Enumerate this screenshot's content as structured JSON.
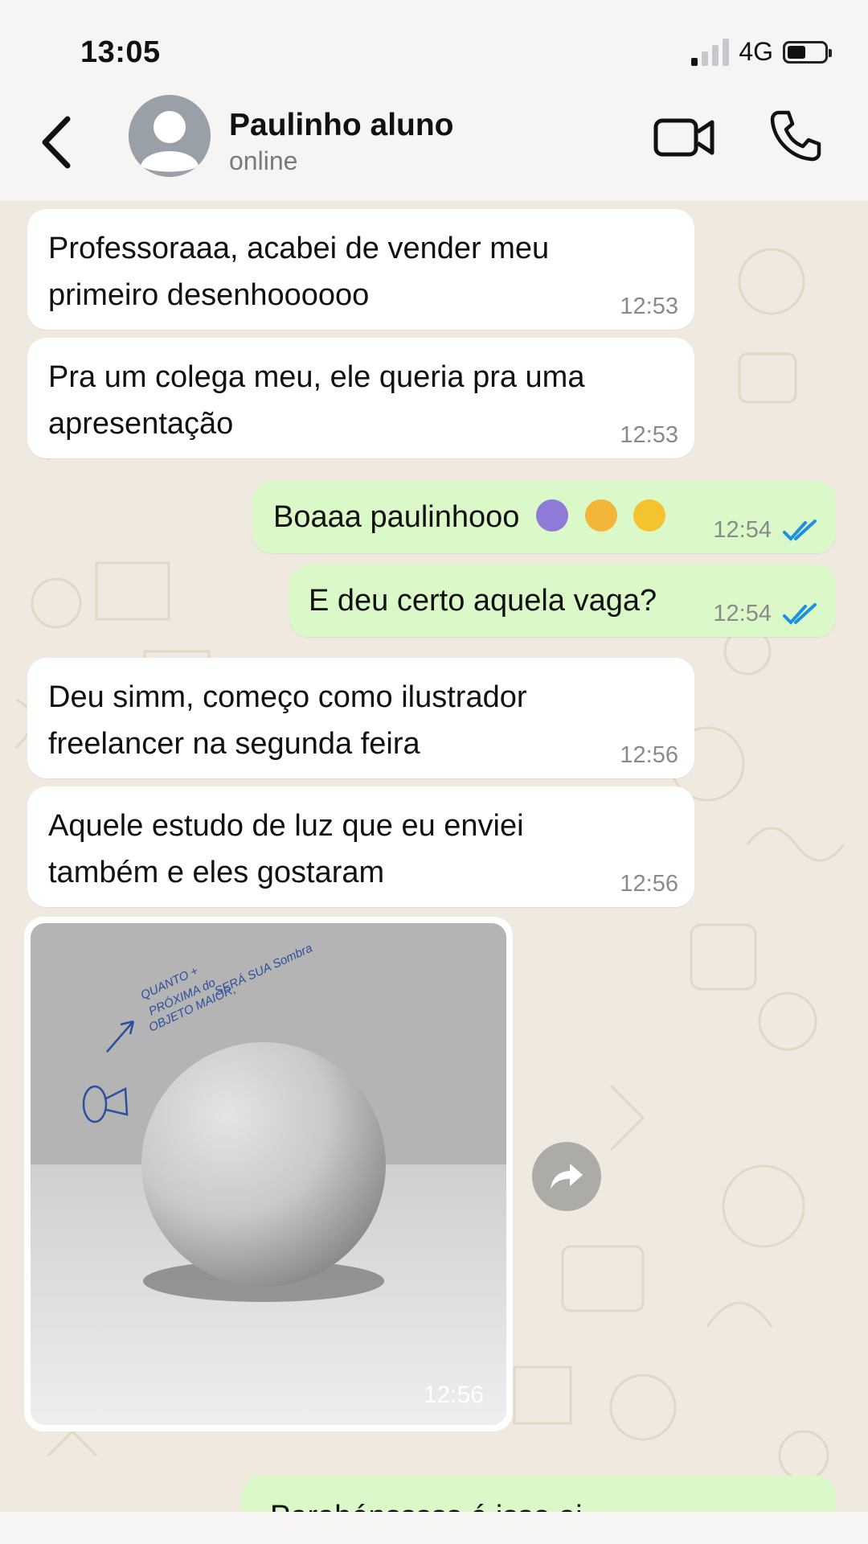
{
  "status_bar": {
    "time": "13:05",
    "network": "4G",
    "signal_bars_filled": 1,
    "battery_level": 0.45
  },
  "header": {
    "contact_name": "Paulinho aluno",
    "contact_status": "online",
    "icons": {
      "back": "chevron-left-icon",
      "avatar": "default-avatar-icon",
      "video": "video-camera-icon",
      "call": "phone-icon"
    }
  },
  "messages": [
    {
      "direction": "in",
      "text_line1": "Professoraaa, acabei de vender meu",
      "text_line2": "primeiro desenhoooooo",
      "time": "12:53"
    },
    {
      "direction": "in",
      "text_line1": "Pra um colega meu, ele queria pra uma",
      "text_line2": "apresentação",
      "time": "12:53"
    },
    {
      "direction": "out",
      "text": "Boaaa paulinhooo",
      "emojis": [
        "folded-hands-emoji",
        "partying-face-emoji",
        "star-struck-emoji"
      ],
      "time": "12:54",
      "status": "read"
    },
    {
      "direction": "out",
      "text": "E deu certo aquela vaga?",
      "time": "12:54",
      "status": "read"
    },
    {
      "direction": "in",
      "text_line1": "Deu simm, começo como ilustrador",
      "text_line2": "freelancer na segunda feira",
      "time": "12:56"
    },
    {
      "direction": "in",
      "text_line1": "Aquele estudo de luz que eu enviei",
      "text_line2": "também e eles gostaram",
      "time": "12:56"
    },
    {
      "direction": "in",
      "type": "image",
      "image_annotation": [
        "QUANTO +",
        "PRÓXIMA do",
        "OBJETO MAIOR,",
        "SERÁ SUA Sombra"
      ],
      "time": "12:56"
    },
    {
      "direction": "out",
      "text": "Parabénsssss é isso ai",
      "partial": true
    }
  ],
  "colors": {
    "incoming_bubble": "#ffffff",
    "outgoing_bubble": "#dbf9c8",
    "chat_background": "#efe9df",
    "read_ticks": "#1f8fe0"
  }
}
